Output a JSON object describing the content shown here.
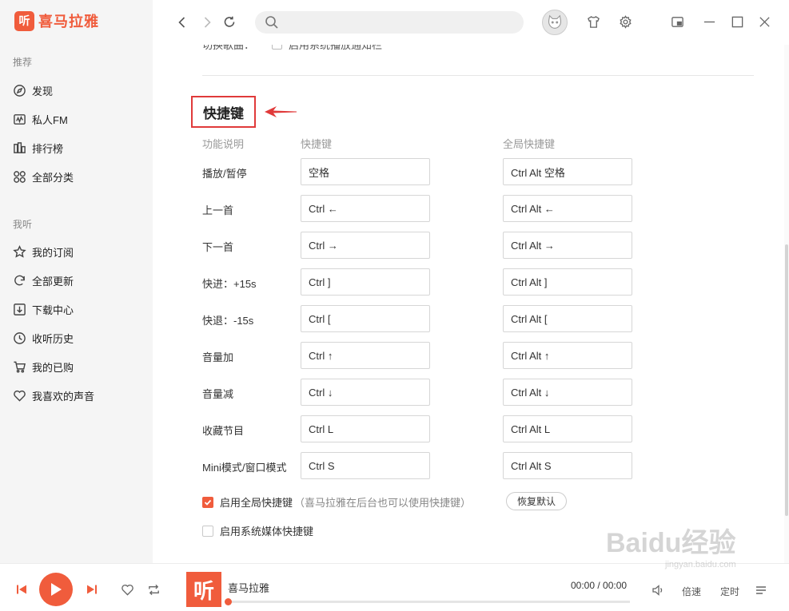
{
  "app": {
    "logo_glyph": "听",
    "logo_text": "喜马拉雅",
    "brand_color": "#f05c3c"
  },
  "sidebar": {
    "section_recommend": "推荐",
    "recommend_items": [
      {
        "label": "发现",
        "icon": "compass-icon"
      },
      {
        "label": "私人FM",
        "icon": "radio-icon"
      },
      {
        "label": "排行榜",
        "icon": "ranking-icon"
      },
      {
        "label": "全部分类",
        "icon": "grid-icon"
      }
    ],
    "section_mine": "我听",
    "mine_items": [
      {
        "label": "我的订阅",
        "icon": "star-icon"
      },
      {
        "label": "全部更新",
        "icon": "refresh-icon"
      },
      {
        "label": "下载中心",
        "icon": "download-icon"
      },
      {
        "label": "收听历史",
        "icon": "clock-icon"
      },
      {
        "label": "我的已购",
        "icon": "cart-icon"
      },
      {
        "label": "我喜欢的声音",
        "icon": "heart-icon"
      }
    ]
  },
  "topbar": {
    "search_placeholder": "",
    "icons": [
      "back-icon",
      "forward-icon",
      "refresh-icon",
      "search-icon",
      "avatar",
      "shirt-icon",
      "gear-icon",
      "mini-mode-icon",
      "minimize-icon",
      "maximize-icon",
      "close-icon"
    ]
  },
  "settings": {
    "cut_row_label": "切换歌曲：",
    "cut_row_option": "启用系统播放通知栏",
    "shortcut_title": "快捷键",
    "col_function": "功能说明",
    "col_shortcut": "快捷键",
    "col_global": "全局快捷键",
    "rows": [
      {
        "label": "播放/暂停",
        "key": "空格",
        "global": "Ctrl Alt 空格"
      },
      {
        "label": "上一首",
        "key": "Ctrl ←",
        "global": "Ctrl Alt ←"
      },
      {
        "label": "下一首",
        "key": "Ctrl →",
        "global": "Ctrl Alt →"
      },
      {
        "label": "快进：+15s",
        "key": "Ctrl ]",
        "global": "Ctrl Alt ]"
      },
      {
        "label": "快退：-15s",
        "key": "Ctrl [",
        "global": "Ctrl Alt ["
      },
      {
        "label": "音量加",
        "key": "Ctrl ↑",
        "global": "Ctrl Alt ↑"
      },
      {
        "label": "音量减",
        "key": "Ctrl ↓",
        "global": "Ctrl Alt ↓"
      },
      {
        "label": "收藏节目",
        "key": "Ctrl L",
        "global": "Ctrl Alt L"
      },
      {
        "label": "Mini模式/窗口模式",
        "key": "Ctrl S",
        "global": "Ctrl Alt S"
      }
    ],
    "global_enable_label": "启用全局快捷键",
    "global_enable_hint": "（喜马拉雅在后台也可以使用快捷键）",
    "global_enable_checked": true,
    "reset_label": "恢复默认",
    "media_keys_label": "启用系统媒体快捷键",
    "media_keys_checked": false
  },
  "player": {
    "cover_glyph": "听",
    "track_title": "喜马拉雅",
    "time_current": "00:00",
    "time_total": "00:00",
    "time_sep": " / ",
    "progress": 0,
    "speed_label": "倍速",
    "timer_label": "定时"
  },
  "watermark": {
    "text": "Baidu经验",
    "url_text": "jingyan.baidu.com"
  }
}
